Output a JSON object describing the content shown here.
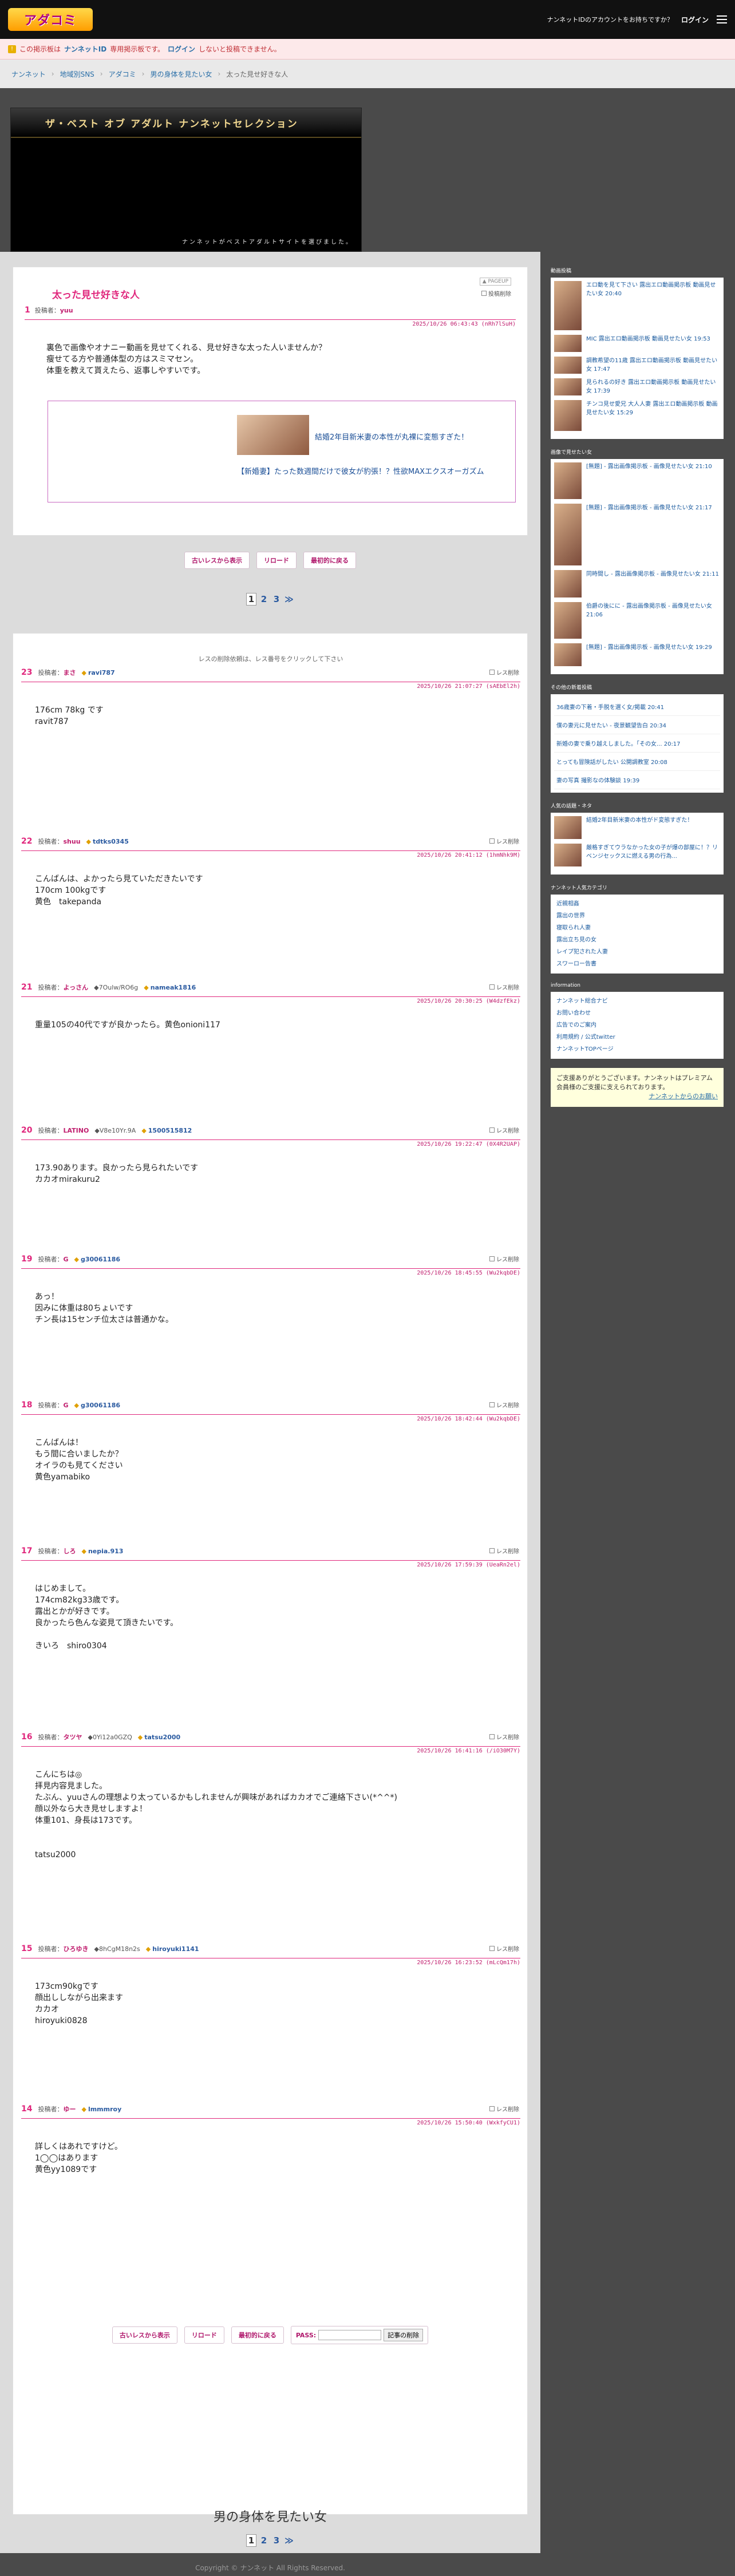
{
  "header": {
    "logo": "アダコミ",
    "account_prompt": "ナンネットIDのアカウントをお持ちですか？",
    "login": "ログイン"
  },
  "notice": {
    "icon": "!",
    "pre": "この掲示板は",
    "id": "ナンネットID",
    "mid": "専用掲示板です。",
    "login": "ログイン",
    "post": "しないと投稿できません。"
  },
  "breadcrumb": [
    "ナンネット",
    "地域別SNS",
    "アダコミ",
    "男の身体を見たい女",
    "太った見せ好きな人"
  ],
  "banner": {
    "title": "ザ・ベスト オブ アダルト ナンネットセレクション",
    "sub": "ナンネットがベストアダルトサイトを選びました。"
  },
  "op": {
    "num": "1",
    "title": "太った見せ好きな人",
    "poster_label": "投稿者：",
    "poster": "yuu",
    "date": "2025/10/26 06:43:43 (nRh7lSuH)",
    "body": "裏色で画像やオナニー動画を見せてくれる、見せ好きな太った人いませんか？\n瘦せてる方や普通体型の方はスミマセン。\n体重を教えて貰えたら、返事しやすいです。",
    "tag": "▲ PAGEUP",
    "delete": "投稿削除",
    "ad_title": "結婚2年目新米妻の本性が丸裸に変態すぎた！",
    "ad_link": "【新婚妻】たった数週間だけで彼女が豹張！？性欲MAXエクスオーガズム"
  },
  "buttons": {
    "all": "古いレスから表示",
    "reload": "リロード",
    "top": "最初的に戻る"
  },
  "pager": {
    "pages": [
      "1",
      "2",
      "3"
    ],
    "next": "≫"
  },
  "hint": "レスの削除依頼は、レス番号をクリックして下さい",
  "reply_delete": "レス削除",
  "replies": [
    {
      "num": "23",
      "poster": "まさ",
      "trip": "ravi787",
      "date": "2025/10/26 21:07:27 (sAEbEl2h)",
      "body": "176cm 78kg です\nravit787"
    },
    {
      "num": "22",
      "poster": "shuu",
      "trip": "tdtks0345",
      "date": "2025/10/26 20:41:12 (1hmNhk9M)",
      "body": "こんばんは、よかったら見ていただきたいです\n170cm 100kgです\n黄色　takepanda"
    },
    {
      "num": "21",
      "poster": "よっさん",
      "extra": "◆7Oulw/RO6g",
      "trip": "nameak1816",
      "date": "2025/10/26 20:30:25 (W4dzfEkz)",
      "body": "重量105の40代ですが良かったら。黄色onioni117"
    },
    {
      "num": "20",
      "poster": "LATINO",
      "extra": "◆V8e10Yr.9A",
      "trip": "1500515812",
      "date": "2025/10/26 19:22:47 (0X4R2UAP)",
      "body": "173.90あります。良かったら見られたいです\nカカオmirakuru2"
    },
    {
      "num": "19",
      "poster": "G",
      "trip": "g30061186",
      "date": "2025/10/26 18:45:55 (Wu2kqbDE)",
      "body": "あっ！\n因みに体重は80ちょいです\nチン長は15センチ位太さは普通かな。"
    },
    {
      "num": "18",
      "poster": "G",
      "trip": "g30061186",
      "date": "2025/10/26 18:42:44 (Wu2kqbDE)",
      "body": "こんばんは！\nもう間に合いましたか？\nオイラのも見てください\n黄色yamabiko"
    },
    {
      "num": "17",
      "poster": "しろ",
      "trip": "nepia.913",
      "date": "2025/10/26 17:59:39 (UeaRn2el)",
      "body": "はじめまして。\n174cm82kg33歳です。\n露出とかが好きです。\n良かったら色んな姿見て頂きたいです。\n\nきいろ　shiro0304"
    },
    {
      "num": "16",
      "poster": "タツヤ",
      "extra": "◆0Yi12a0GZQ",
      "trip": "tatsu2000",
      "date": "2025/10/26 16:41:16 (/iO30M7Y)",
      "body": "こんにちは◎\n拝見内容見ました。\nたぶん、yuuさんの理想より太っているかもしれませんが興味があればカカオでご連絡下さい(*^^*)\n顔以外なら大き見せしますよ！\n体重101、身長は173です。\n\n\ntatsu2000"
    },
    {
      "num": "15",
      "poster": "ひろゆき",
      "extra": "◆8hCgM18n2s",
      "trip": "hiroyuki1141",
      "date": "2025/10/26 16:23:52 (mLcQm17h)",
      "body": "173cm90kgです\n顔出ししながら出来ます\nカカオ\nhiroyuki0828"
    },
    {
      "num": "14",
      "poster": "ゆー",
      "trip": "lmmmroy",
      "date": "2025/10/26 15:50:40 (WxkfyCU1)",
      "body": "詳しくはあれですけど。\n1◯◯はあります\n黄色yy1089です"
    }
  ],
  "bottom": {
    "pass_label": "PASS:",
    "delete_btn": "記事の削除"
  },
  "footer": {
    "title": "男の身体を見たい女",
    "copyright": "Copyright © ナンネット All Rights Reserved."
  },
  "sidebar": {
    "sec1": "動画投稿",
    "videos": [
      {
        "t": "エロ動を見て下さい 露出エロ動画掲示板 動画見せたい女 20:40",
        "h": 86
      },
      {
        "t": "MIC 露出エロ動画掲示板 動画見せたい女 19:53",
        "h": 30
      },
      {
        "t": "調教希望の11歳 露出エロ動画掲示板 動画見せたい女 17:47",
        "h": 30
      },
      {
        "t": "見られるの好き 露出エロ動画掲示板 動画見せたい女 17:39",
        "h": 30
      },
      {
        "t": "チンコ見せ愛兄 大人人妻 露出エロ動画掲示板 動画見せたい女 15:29",
        "h": 54
      }
    ],
    "sec2": "画像で見せたい女",
    "photos": [
      {
        "t": "[無題] - 露出画像掲示板 - 画像見せたい女 21:10",
        "h": 64
      },
      {
        "t": "[無題] - 露出画像掲示板 - 画像見せたい女 21:17",
        "h": 108
      },
      {
        "t": "同時間し - 露出画像掲示板 - 画像見せたい女 21:11",
        "h": 48
      },
      {
        "t": "伯爵の後にに - 露出画像掲示板 - 画像見せたい女 21:06",
        "h": 64
      },
      {
        "t": "[無題] - 露出画像掲示板 - 画像見せたい女 19:29",
        "h": 40
      }
    ],
    "sec3": "その他の新着投稿",
    "news": [
      "36歳妻の下着・手脱を選く女/掲載 20:41",
      "僕の妻元に見せたい - 夜景観望告白 20:34",
      "新婚の妻で乗り越えしました。「その女... 20:17",
      "とっても冒険話がしたい 公開調教室 20:08",
      "妻の写真 撮影なの体験談 19:39"
    ],
    "sec4": "人気の話題・ネタ",
    "topics": [
      {
        "t": "結婚2年目新米妻の本性がド変態すぎた！"
      },
      {
        "t": "厳格すぎてウラなかった女の子が爆の部屋に！？リベンジセックスに燃える男の行為..."
      }
    ],
    "sec5": "ナンネット人気カテゴリ",
    "cats": [
      "近親相姦",
      "露出の世界",
      "寝取られ人妻",
      "露出立ち見の女",
      "レイプ犯された人妻",
      "スワーロー告書"
    ],
    "sec6": "information",
    "info": [
      "ナンネット総合ナビ",
      "お問い合わせ",
      "広告でのご案内",
      "利用規約 / 公式twitter",
      "ナンネットTOPページ"
    ],
    "infobox": "ご支援ありがとうございます。ナンネットはプレミアム会員様のご支援に支えられております。",
    "infobox_link": "ナンネットからのお願い"
  }
}
